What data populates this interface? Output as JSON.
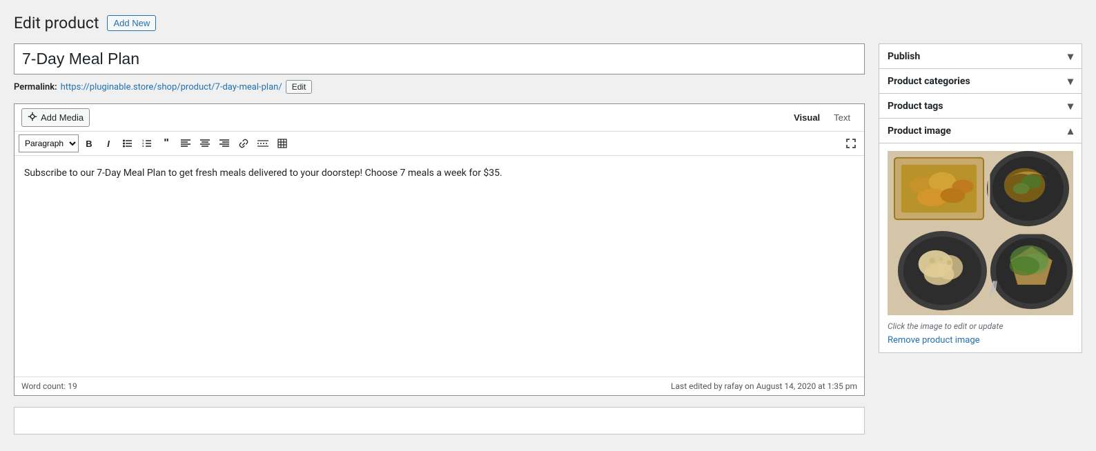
{
  "page": {
    "title": "Edit product",
    "add_new_label": "Add New"
  },
  "product": {
    "title": "7-Day Meal Plan",
    "permalink_label": "Permalink:",
    "permalink_url": "https://pluginoble.store/shop/product/7-day-meal-plan/",
    "permalink_display": "https://plug‌inable.store/shop/product/7-day-meal-plan/",
    "edit_btn_label": "Edit",
    "description": "Subscribe to our 7-Day Meal Plan to get fresh meals delivered to your doorstep! Choose 7 meals a week for $35."
  },
  "editor": {
    "add_media_label": "Add Media",
    "visual_tab": "Visual",
    "text_tab": "Text",
    "active_tab": "visual",
    "paragraph_option": "Paragraph",
    "word_count_label": "Word count:",
    "word_count": "19",
    "last_edited": "Last edited by rafay on August 14, 2020 at 1:35 pm",
    "toolbar": {
      "bold": "B",
      "italic": "I",
      "unordered_list": "≡",
      "ordered_list": "≡",
      "blockquote": "❝",
      "align_left": "◀",
      "align_center": "▬",
      "align_right": "▶",
      "link": "🔗",
      "more": "—",
      "table": "⊞"
    }
  },
  "sidebar": {
    "publish_panel": {
      "label": "Publish",
      "expanded": false
    },
    "product_categories_panel": {
      "label": "Product categories",
      "expanded": false
    },
    "product_tags_panel": {
      "label": "Product tags",
      "expanded": false
    },
    "product_image_panel": {
      "label": "Product image",
      "expanded": true,
      "caption": "Click the image to edit or update",
      "remove_label": "Remove product image"
    }
  }
}
